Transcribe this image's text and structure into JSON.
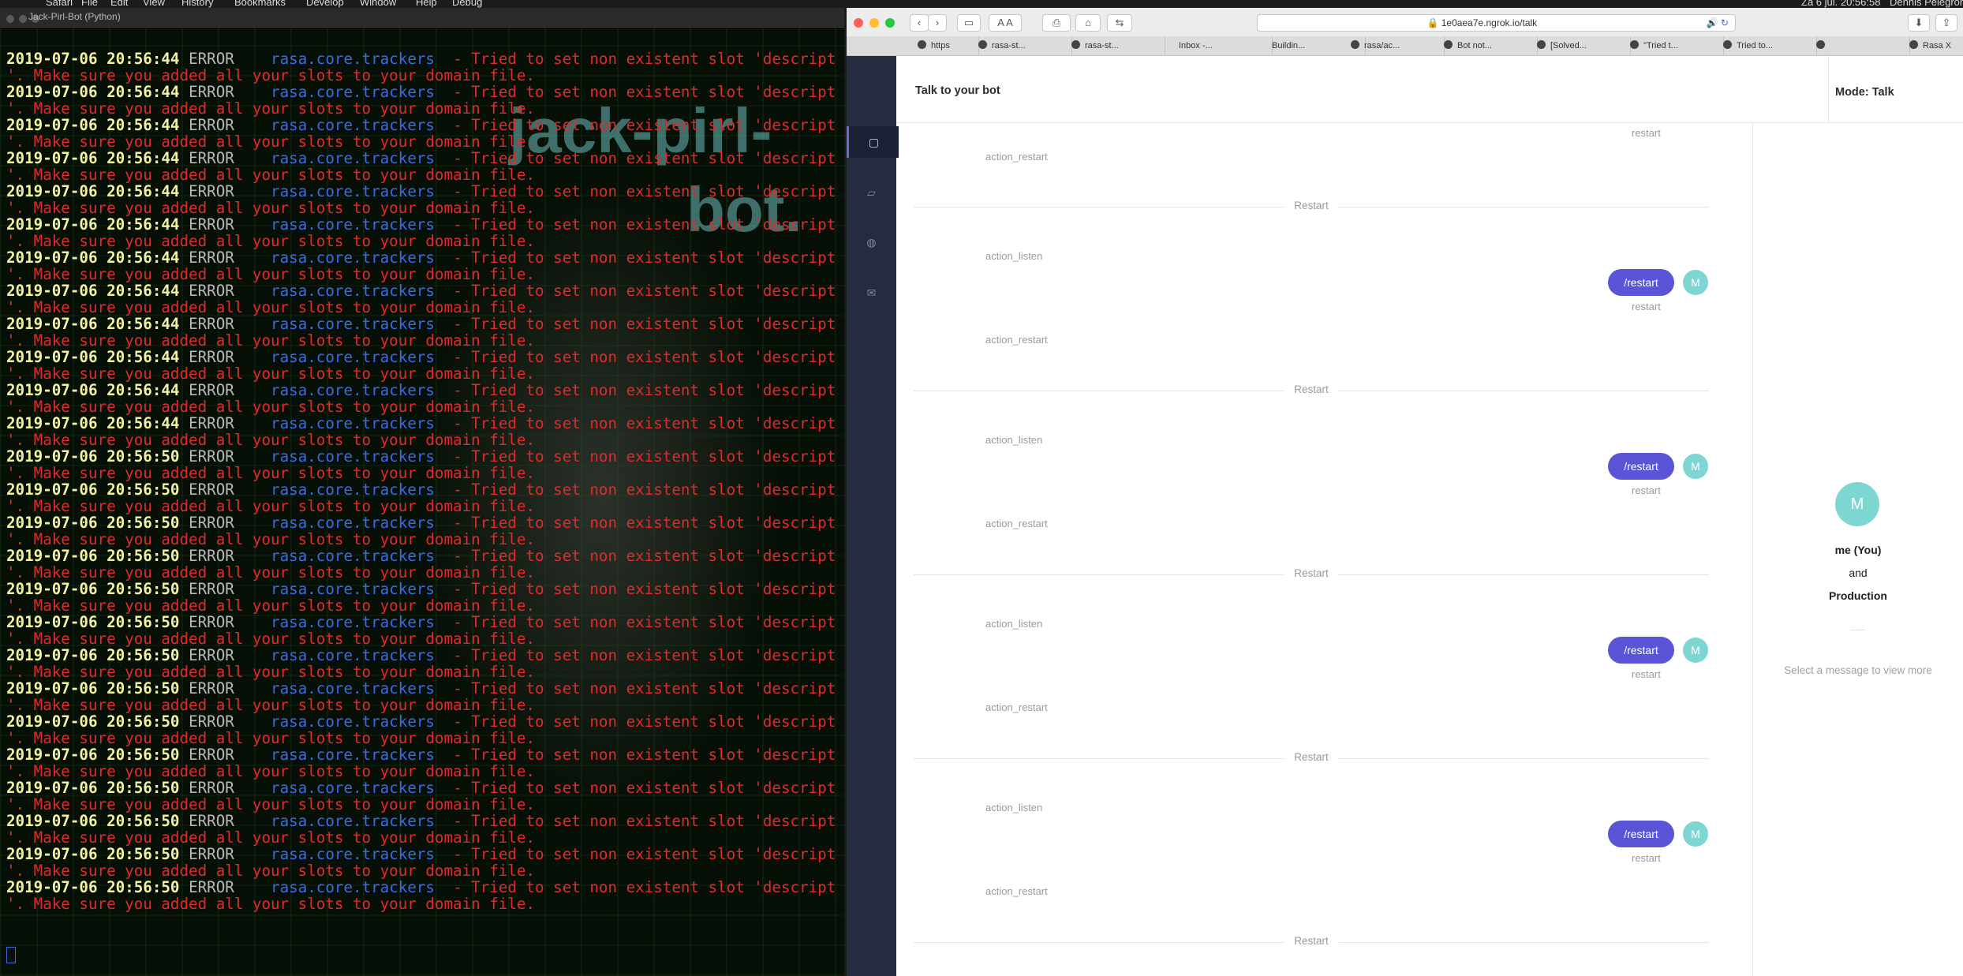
{
  "menubar": {
    "items": [
      "Safari",
      "File",
      "Edit",
      "View",
      "History",
      "Bookmarks",
      "Develop",
      "Window",
      "Help",
      "Debug"
    ],
    "clock": "Za 6 jul. 20:56:58",
    "user": "Dennis Pelegrom"
  },
  "terminal": {
    "title": "Jack-Pirl-Bot (Python)",
    "watermark_line1": "jack-pirl-",
    "watermark_line2": "bot.",
    "log_entries": [
      {
        "ts": "2019-07-06 20:56:44"
      },
      {
        "ts": "2019-07-06 20:56:44"
      },
      {
        "ts": "2019-07-06 20:56:44"
      },
      {
        "ts": "2019-07-06 20:56:44"
      },
      {
        "ts": "2019-07-06 20:56:44"
      },
      {
        "ts": "2019-07-06 20:56:44"
      },
      {
        "ts": "2019-07-06 20:56:44"
      },
      {
        "ts": "2019-07-06 20:56:44"
      },
      {
        "ts": "2019-07-06 20:56:44"
      },
      {
        "ts": "2019-07-06 20:56:44"
      },
      {
        "ts": "2019-07-06 20:56:44"
      },
      {
        "ts": "2019-07-06 20:56:44"
      },
      {
        "ts": "2019-07-06 20:56:50"
      },
      {
        "ts": "2019-07-06 20:56:50"
      },
      {
        "ts": "2019-07-06 20:56:50"
      },
      {
        "ts": "2019-07-06 20:56:50"
      },
      {
        "ts": "2019-07-06 20:56:50"
      },
      {
        "ts": "2019-07-06 20:56:50"
      },
      {
        "ts": "2019-07-06 20:56:50"
      },
      {
        "ts": "2019-07-06 20:56:50"
      },
      {
        "ts": "2019-07-06 20:56:50"
      },
      {
        "ts": "2019-07-06 20:56:50"
      },
      {
        "ts": "2019-07-06 20:56:50"
      },
      {
        "ts": "2019-07-06 20:56:50"
      },
      {
        "ts": "2019-07-06 20:56:50"
      },
      {
        "ts": "2019-07-06 20:56:50"
      }
    ],
    "level": "ERROR",
    "module": "rasa.core.trackers",
    "message": "- Tried to set non existent slot 'description",
    "continuation": "'. Make sure you added all your slots to your domain file."
  },
  "browser": {
    "url": "1e0aea7e.ngrok.io/talk",
    "tabs": [
      "https",
      "rasa-st...",
      "rasa-st...",
      "Inbox -...",
      "Buildin...",
      "rasa/ac...",
      "Bot not...",
      "[Solved...",
      "\"Tried t...",
      "Tried to...",
      "",
      "Rasa X"
    ],
    "sidebar_icons": [
      "chat-bubble",
      "conversations",
      "training",
      "inbox"
    ],
    "header_title": "Talk to your bot",
    "mode": "Mode: Talk"
  },
  "chat": {
    "top_label": "restart",
    "bot_actions": {
      "restart": "action_restart",
      "listen": "action_listen"
    },
    "separator": "Restart",
    "user_message": "/restart",
    "user_label": "restart",
    "avatar_initial": "M"
  },
  "info": {
    "avatar_initial": "M",
    "me": "me (You)",
    "and": "and",
    "env": "Production",
    "hint": "Select a message to view more"
  }
}
